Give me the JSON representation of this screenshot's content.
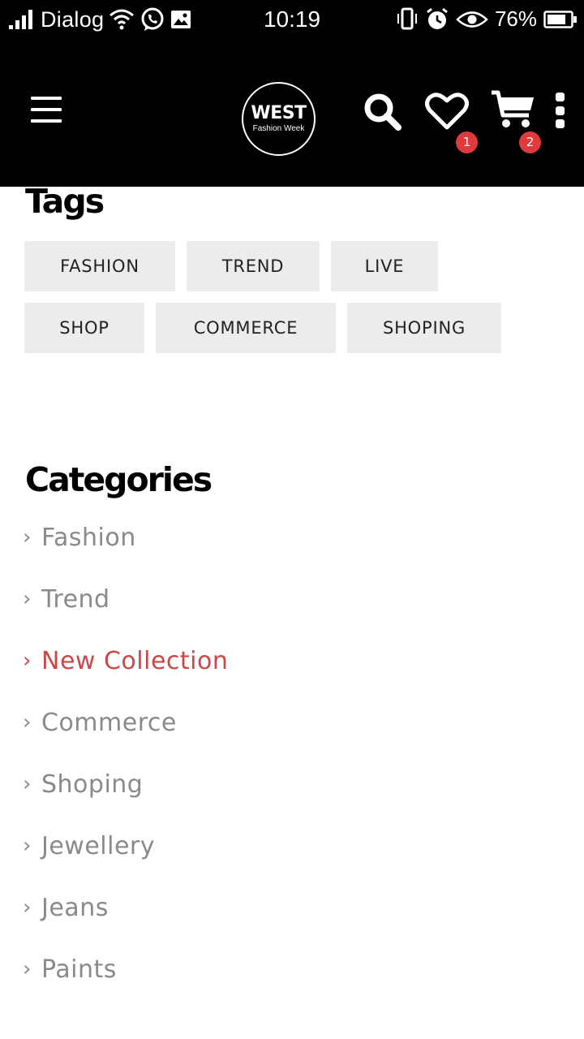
{
  "status_bar": {
    "carrier": "Dialog",
    "time": "10:19",
    "battery": "76%",
    "icons": [
      "signal-icon",
      "wifi-icon",
      "whatsapp-icon",
      "image-icon",
      "vibrate-icon",
      "alarm-icon",
      "eye-icon",
      "battery-icon"
    ]
  },
  "header": {
    "logo_main": "WEST",
    "logo_sub": "Fashion Week",
    "wishlist_count": "1",
    "cart_count": "2",
    "accent_color": "#e0393e"
  },
  "tags": {
    "title": "Tags",
    "items": [
      "FASHION",
      "TREND",
      "LIVE",
      "SHOP",
      "COMMERCE",
      "SHOPING"
    ]
  },
  "categories": {
    "title": "Categories",
    "chevron": "›",
    "active_color": "#c9484a",
    "items": [
      "Fashion",
      "Trend",
      "New Collection",
      "Commerce",
      "Shoping",
      "Jewellery",
      "Jeans",
      "Paints"
    ],
    "active_item": "New Collection"
  }
}
